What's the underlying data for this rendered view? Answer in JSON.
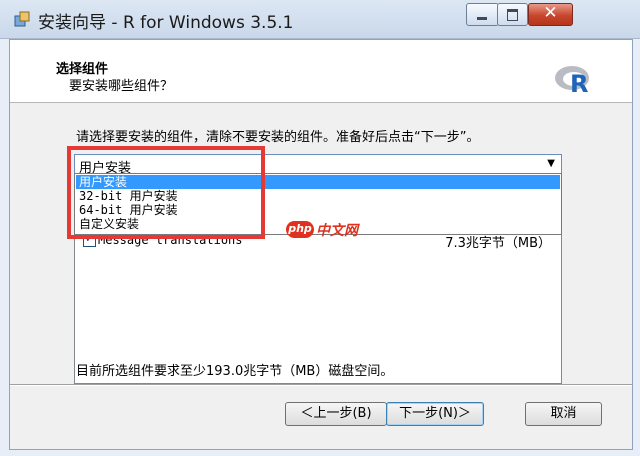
{
  "window": {
    "title": "安装向导 - R for Windows 3.5.1"
  },
  "header": {
    "title": "选择组件",
    "subtitle": "要安装哪些组件？",
    "logo": "R"
  },
  "instruction": "请选择要安装的组件，清除不要安装的组件。准备好后点击“下一步”。",
  "combo": {
    "selected": "用户安装",
    "options": [
      "用户安装",
      "32-bit 用户安装",
      "64-bit 用户安装",
      "自定义安装"
    ]
  },
  "components": [
    {
      "name": "Message translations",
      "size": "7.3兆字节（MB）",
      "checked": true
    }
  ],
  "space_required": "目前所选组件要求至少193.0兆字节（MB）磁盘空间。",
  "buttons": {
    "back": "＜上一步(B)",
    "next": "下一步(N)＞",
    "cancel": "取消"
  },
  "watermark": {
    "badge": "php",
    "text": "中文网"
  },
  "colors": {
    "highlight": "#3399ff",
    "annotation_red": "#e53935",
    "brand_red": "#e0301e"
  }
}
